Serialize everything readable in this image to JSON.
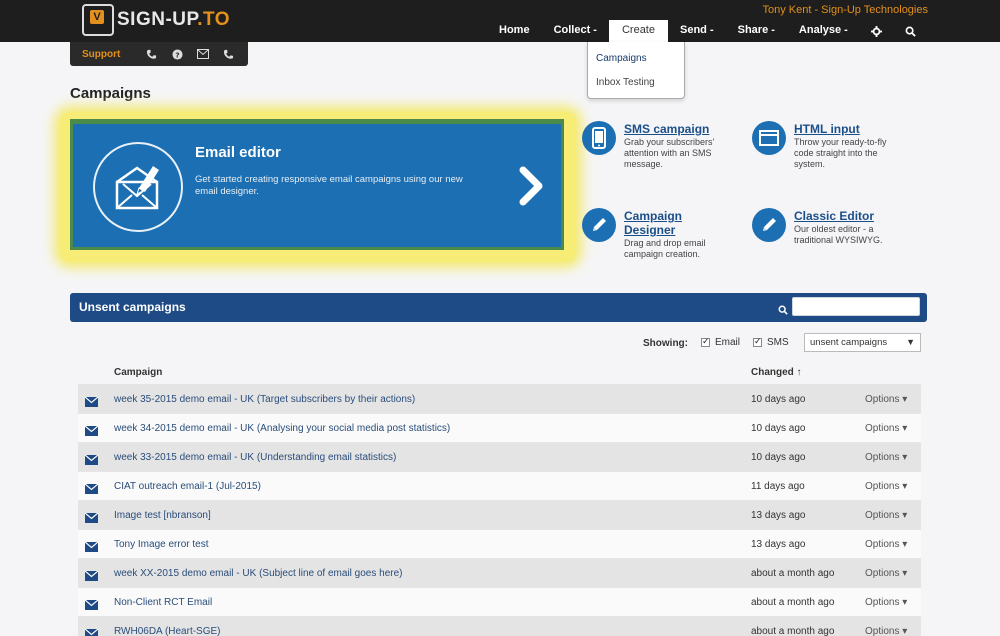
{
  "header": {
    "logo_text_main": "SIGN-UP",
    "logo_text_dot": ".TO",
    "logo_mark": "V",
    "user": "Tony Kent - Sign-Up Technologies",
    "nav": [
      "Home",
      "Collect -",
      "Create",
      "Send -",
      "Share -",
      "Analyse -"
    ],
    "nav_active": "Create",
    "nav_icons": [
      "gear-icon",
      "search-icon"
    ]
  },
  "support_bar": {
    "label": "Support",
    "icons": [
      "phone-chat-icon",
      "help-icon",
      "mail-icon",
      "phone-icon"
    ]
  },
  "create_dropdown": {
    "items": [
      "Campaigns",
      "Inbox Testing"
    ]
  },
  "page": {
    "title": "Campaigns"
  },
  "hero": {
    "title": "Email editor",
    "description": "Get started creating responsive email campaigns using our new email designer."
  },
  "tiles": [
    {
      "title": "SMS campaign",
      "description": "Grab your subscribers' attention with an SMS message.",
      "icon": "mobile-phone-icon"
    },
    {
      "title": "HTML input",
      "description": "Throw your ready-to-fly code straight into the system.",
      "icon": "browser-window-icon"
    },
    {
      "title": "Campaign Designer",
      "description": "Drag and drop email campaign creation.",
      "icon": "pencil-icon"
    },
    {
      "title": "Classic Editor",
      "description": "Our oldest editor - a traditional WYSIWYG.",
      "icon": "pencil-icon"
    }
  ],
  "unsent": {
    "title": "Unsent campaigns",
    "search_value": "",
    "showing_label": "Showing:",
    "filter_email": "Email",
    "filter_sms": "SMS",
    "select_value": "unsent campaigns",
    "columns": {
      "campaign": "Campaign",
      "changed": "Changed ↑"
    },
    "rows": [
      {
        "name": "week 35-2015 demo email - UK (Target subscribers by their actions)",
        "changed": "10 days ago",
        "options": "Options ▾"
      },
      {
        "name": "week 34-2015 demo email - UK (Analysing your social media post statistics)",
        "changed": "10 days ago",
        "options": "Options ▾"
      },
      {
        "name": "week 33-2015 demo email - UK (Understanding email statistics)",
        "changed": "10 days ago",
        "options": "Options ▾"
      },
      {
        "name": "CIAT outreach email-1 (Jul-2015)",
        "changed": "11 days ago",
        "options": "Options ▾"
      },
      {
        "name": "Image test [nbranson]",
        "changed": "13 days ago",
        "options": "Options ▾"
      },
      {
        "name": "Tony Image error test",
        "changed": "13 days ago",
        "options": "Options ▾"
      },
      {
        "name": "week XX-2015 demo email - UK (Subject line of email goes here)",
        "changed": "about a month ago",
        "options": "Options ▾"
      },
      {
        "name": "Non-Client RCT Email",
        "changed": "about a month ago",
        "options": "Options ▾"
      },
      {
        "name": "RWH06DA (Heart-SGE)",
        "changed": "about a month ago",
        "options": "Options ▾"
      }
    ]
  },
  "colors": {
    "accent_orange": "#e3901c",
    "primary_blue": "#1b6fb2",
    "header_blue": "#1e4a86",
    "highlight_yellow": "#f6ec76"
  }
}
